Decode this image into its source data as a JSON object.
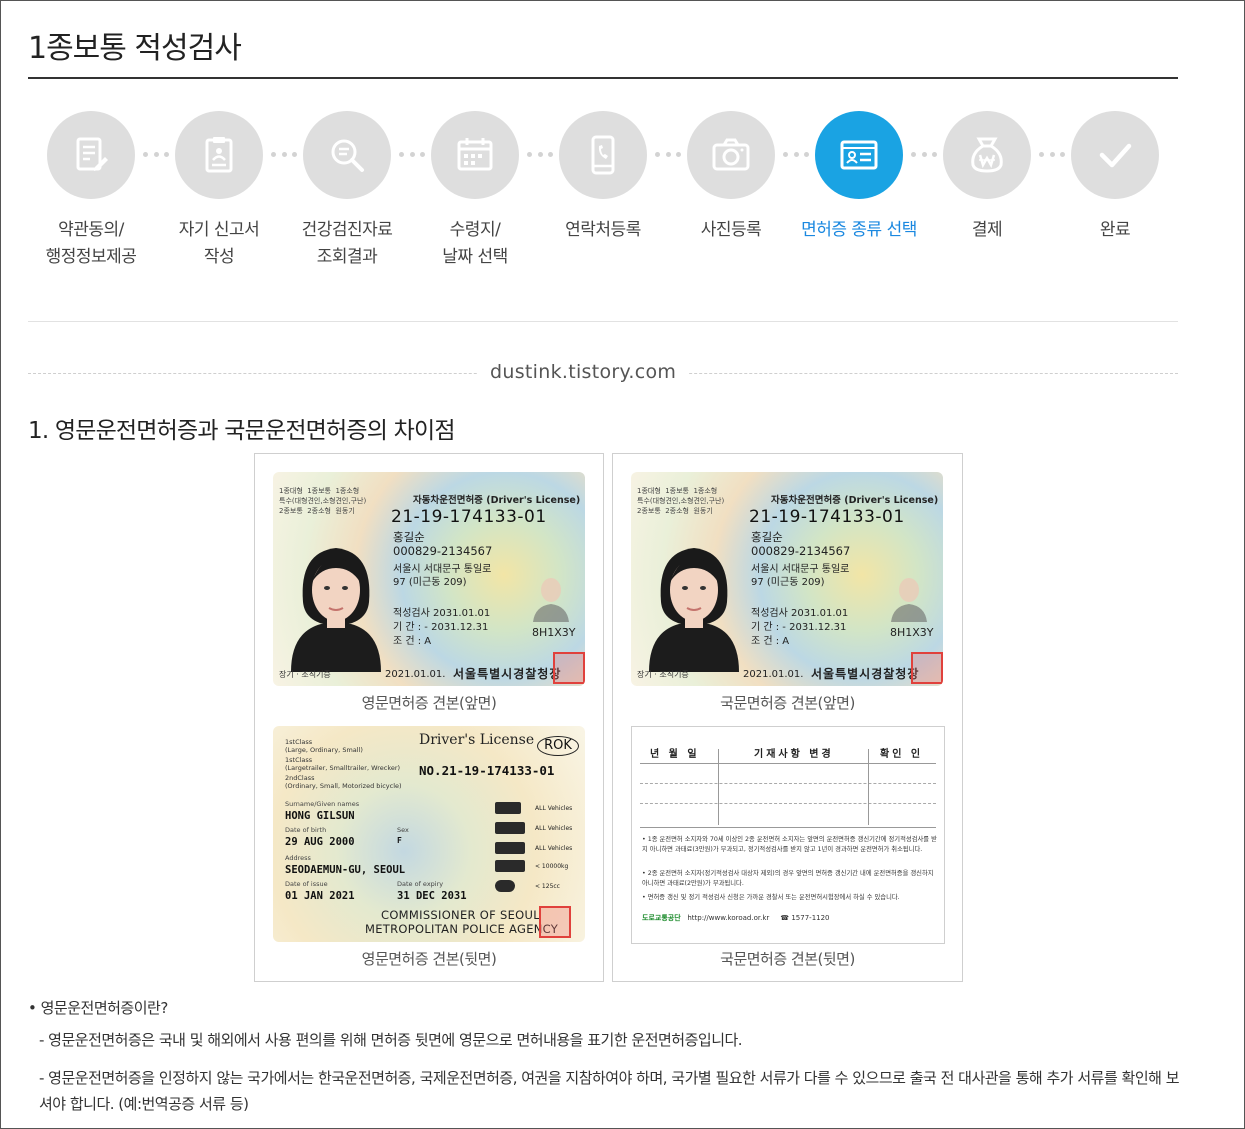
{
  "page": {
    "title": "1종보통 적성검사"
  },
  "steps": [
    {
      "label": "약관동의/\n행정정보제공",
      "icon": "document-edit-icon",
      "active": false
    },
    {
      "label": "자기 신고서\n작성",
      "icon": "clipboard-icon",
      "active": false
    },
    {
      "label": "건강검진자료\n조회결과",
      "icon": "search-document-icon",
      "active": false
    },
    {
      "label": "수령지/\n날짜 선택",
      "icon": "calendar-icon",
      "active": false
    },
    {
      "label": "연락처등록",
      "icon": "phone-icon",
      "active": false
    },
    {
      "label": "사진등록",
      "icon": "camera-icon",
      "active": false
    },
    {
      "label": "면허증 종류 선택",
      "icon": "id-card-icon",
      "active": true
    },
    {
      "label": "결제",
      "icon": "money-bag-icon",
      "active": false
    },
    {
      "label": "완료",
      "icon": "check-icon",
      "active": false
    }
  ],
  "colors": {
    "active": "#1aa3e3",
    "inactive": "#dedede",
    "active_text": "#1a88e0"
  },
  "watermark": "dustink.tistory.com",
  "section": {
    "title": "1. 영문운전면허증과 국문운전면허증의 차이점"
  },
  "card_front": {
    "classes": "1종대형  1종보통  1종소형\n특수(대형견인,소형견인,구난)\n2종보통  2종소형  원동기",
    "type": "자동차운전면허증 (Driver's License)",
    "number": "21-19-174133-01",
    "name": "홍길순",
    "id": "000829-2134567",
    "address1": "서울시 서대문구 통일로",
    "address2": "97 (미근동 209)",
    "exam": "적성검사    2031.01.01",
    "period": "기     간 :  - 2031.12.31",
    "condition": "조     건 : A",
    "code": "8H1X3Y",
    "footer": "장기 · 조직기증",
    "issued": "2021.01.01.",
    "authority": "서울특별시경찰청장"
  },
  "card_back_en": {
    "class1": "1stClass\n(Large, Ordinary, Small)",
    "class2": "1stClass\n(Largetrailer, Smalltrailer, Wrecker)",
    "class3": "2ndClass\n(Ordinary, Small, Motorized bicycle)",
    "title": "Driver's License",
    "rok": "ROK",
    "number": "NO.21-19-174133-01",
    "label_name": "Surname/Given names",
    "name": "HONG GILSUN",
    "label_birth": "Date of birth",
    "label_sex": "Sex",
    "birth": "29 AUG 2000",
    "sex": "F",
    "label_address": "Address",
    "address": "SEODAEMUN-GU, SEOUL",
    "label_issue": "Date of issue",
    "label_expiry": "Date of expiry",
    "issue": "01 JAN 2021",
    "expiry": "31 DEC 2031",
    "vehicles": [
      "ALL Vehicles",
      "ALL Vehicles",
      "ALL Vehicles",
      "< 10000kg",
      "< 125cc"
    ],
    "commissioner1": "COMMISSIONER OF SEOUL",
    "commissioner2": "METROPOLITAN POLICE AGENCY"
  },
  "card_back_kr": {
    "head_date": "년 월 일",
    "head_change": "기재사항 변경",
    "head_confirm": "확인 인",
    "note1": "• 1종 운전면허 소지자와 70세 이상인 2종 운전면허 소지자는 앞면의 운전면허증 갱신기간에 정기적성검사를 받지 아니하면 과태료(3만원)가 부과되고, 정기적성검사를 받지 않고 1년이 경과하면 운전면허가 취소됩니다.",
    "note2": "• 2종 운전면허 소지자(정기적성검사 대상자 제외)의 경우 앞면의 면허증 갱신기간 내에 운전면허증을 갱신하지 아니하면 과태료(2만원)가 부과됩니다.",
    "note3": "• 면허증 갱신 및 정기 적성검사 신청은 가까운 경찰서 또는 운전면허시험장에서 하실 수 있습니다.",
    "org": "도로교통공단",
    "url": "http://www.koroad.or.kr",
    "phone": "☎ 1577-1120"
  },
  "captions": {
    "en_front": "영문면허증 견본(앞면)",
    "kr_front": "국문면허증 견본(앞면)",
    "en_back": "영문면허증 견본(뒷면)",
    "kr_back": "국문면허증 견본(뒷면)"
  },
  "info": {
    "heading": "• 영문운전면허증이란?",
    "line1": "- 영문운전면허증은 국내 및 해외에서 사용 편의를 위해 면허증 뒷면에 영문으로 면허내용을 표기한 운전면허증입니다.",
    "line2": "- 영문운전면허증을 인정하지 않는 국가에서는 한국운전면허증, 국제운전면허증, 여권을 지참하여야 하며, 국가별 필요한 서류가 다를 수 있으므로 출국 전 대사관을 통해 추가 서류를 확인해 보셔야 합니다. (예:번역공증 서류 등)"
  }
}
